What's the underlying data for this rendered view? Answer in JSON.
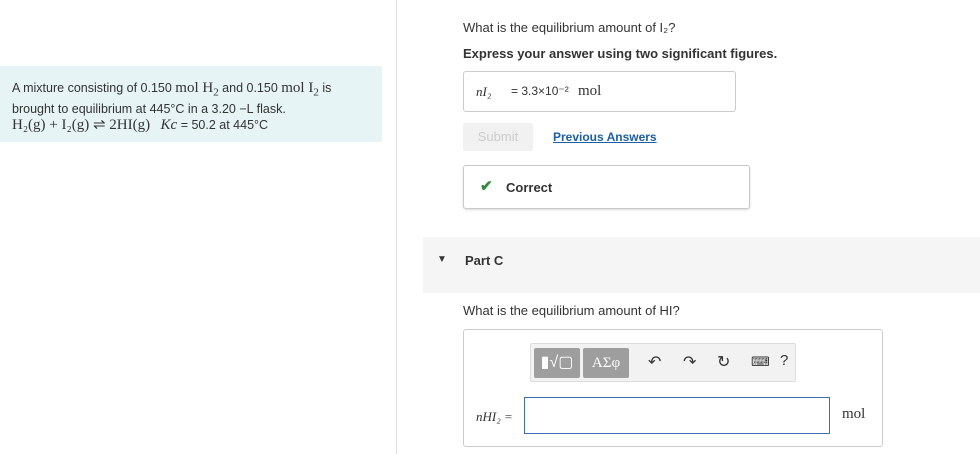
{
  "problem": {
    "line1_a": "A mixture consisting of 0.150 ",
    "line1_b": "mol H",
    "line1_c": " and 0.150 ",
    "line1_d": "mol I",
    "line1_e": " is",
    "line2": "brought to equilibrium at 445°C in a 3.20 −L flask.",
    "equation": "H₂(g) + I₂(g) ⇌ 2HI(g)",
    "kc_label": "Kc",
    "kc_value": " = 50.2 at 445°C"
  },
  "partB": {
    "question": "What is the equilibrium amount of I₂?",
    "instruction": "Express your answer using two significant figures.",
    "answer_label": "nI₂",
    "answer_value": "= 3.3×10⁻² ",
    "answer_unit": "mol",
    "submit_label": "Submit",
    "previous_answers": "Previous Answers",
    "feedback": "Correct"
  },
  "partC": {
    "label": "Part C",
    "question": "What is the equilibrium amount of HI?",
    "input_label": "nHI₂  =",
    "input_value": "",
    "unit": "mol",
    "toolbar": {
      "template_icon": "template-icon",
      "greek_label": "ΑΣφ",
      "undo_icon": "undo-icon",
      "redo_icon": "redo-icon",
      "reset_icon": "reset-icon",
      "keyboard_icon": "keyboard-icon",
      "help_label": "?"
    }
  },
  "colors": {
    "accent": "#1b5fa6",
    "correct": "#2e8b3a",
    "panel": "#e6f4f5"
  }
}
